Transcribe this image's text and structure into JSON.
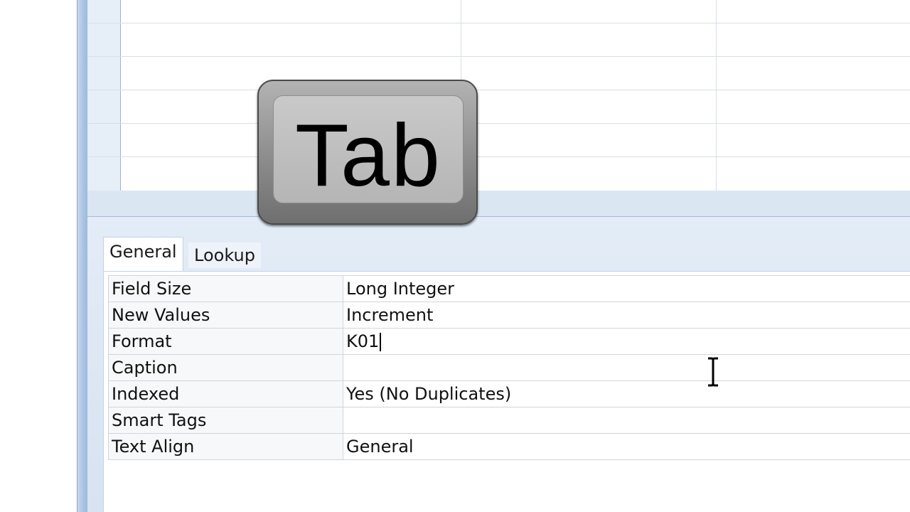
{
  "key_overlay": {
    "label": "Tab"
  },
  "property_tabs": [
    {
      "label": "General",
      "selected": true
    },
    {
      "label": "Lookup",
      "selected": false
    }
  ],
  "properties": [
    {
      "name": "Field Size",
      "value": "Long Integer"
    },
    {
      "name": "New Values",
      "value": "Increment"
    },
    {
      "name": "Format",
      "value": "K01",
      "editing": true
    },
    {
      "name": "Caption",
      "value": ""
    },
    {
      "name": "Indexed",
      "value": "Yes (No Duplicates)"
    },
    {
      "name": "Smart Tags",
      "value": ""
    },
    {
      "name": "Text Align",
      "value": "General"
    }
  ],
  "cursor": {
    "type": "ibeam-icon"
  },
  "colors": {
    "frame_accent": "#a9c3e3",
    "pane_background": "#dbe6f3",
    "key_gray": "#8c8c8c"
  }
}
